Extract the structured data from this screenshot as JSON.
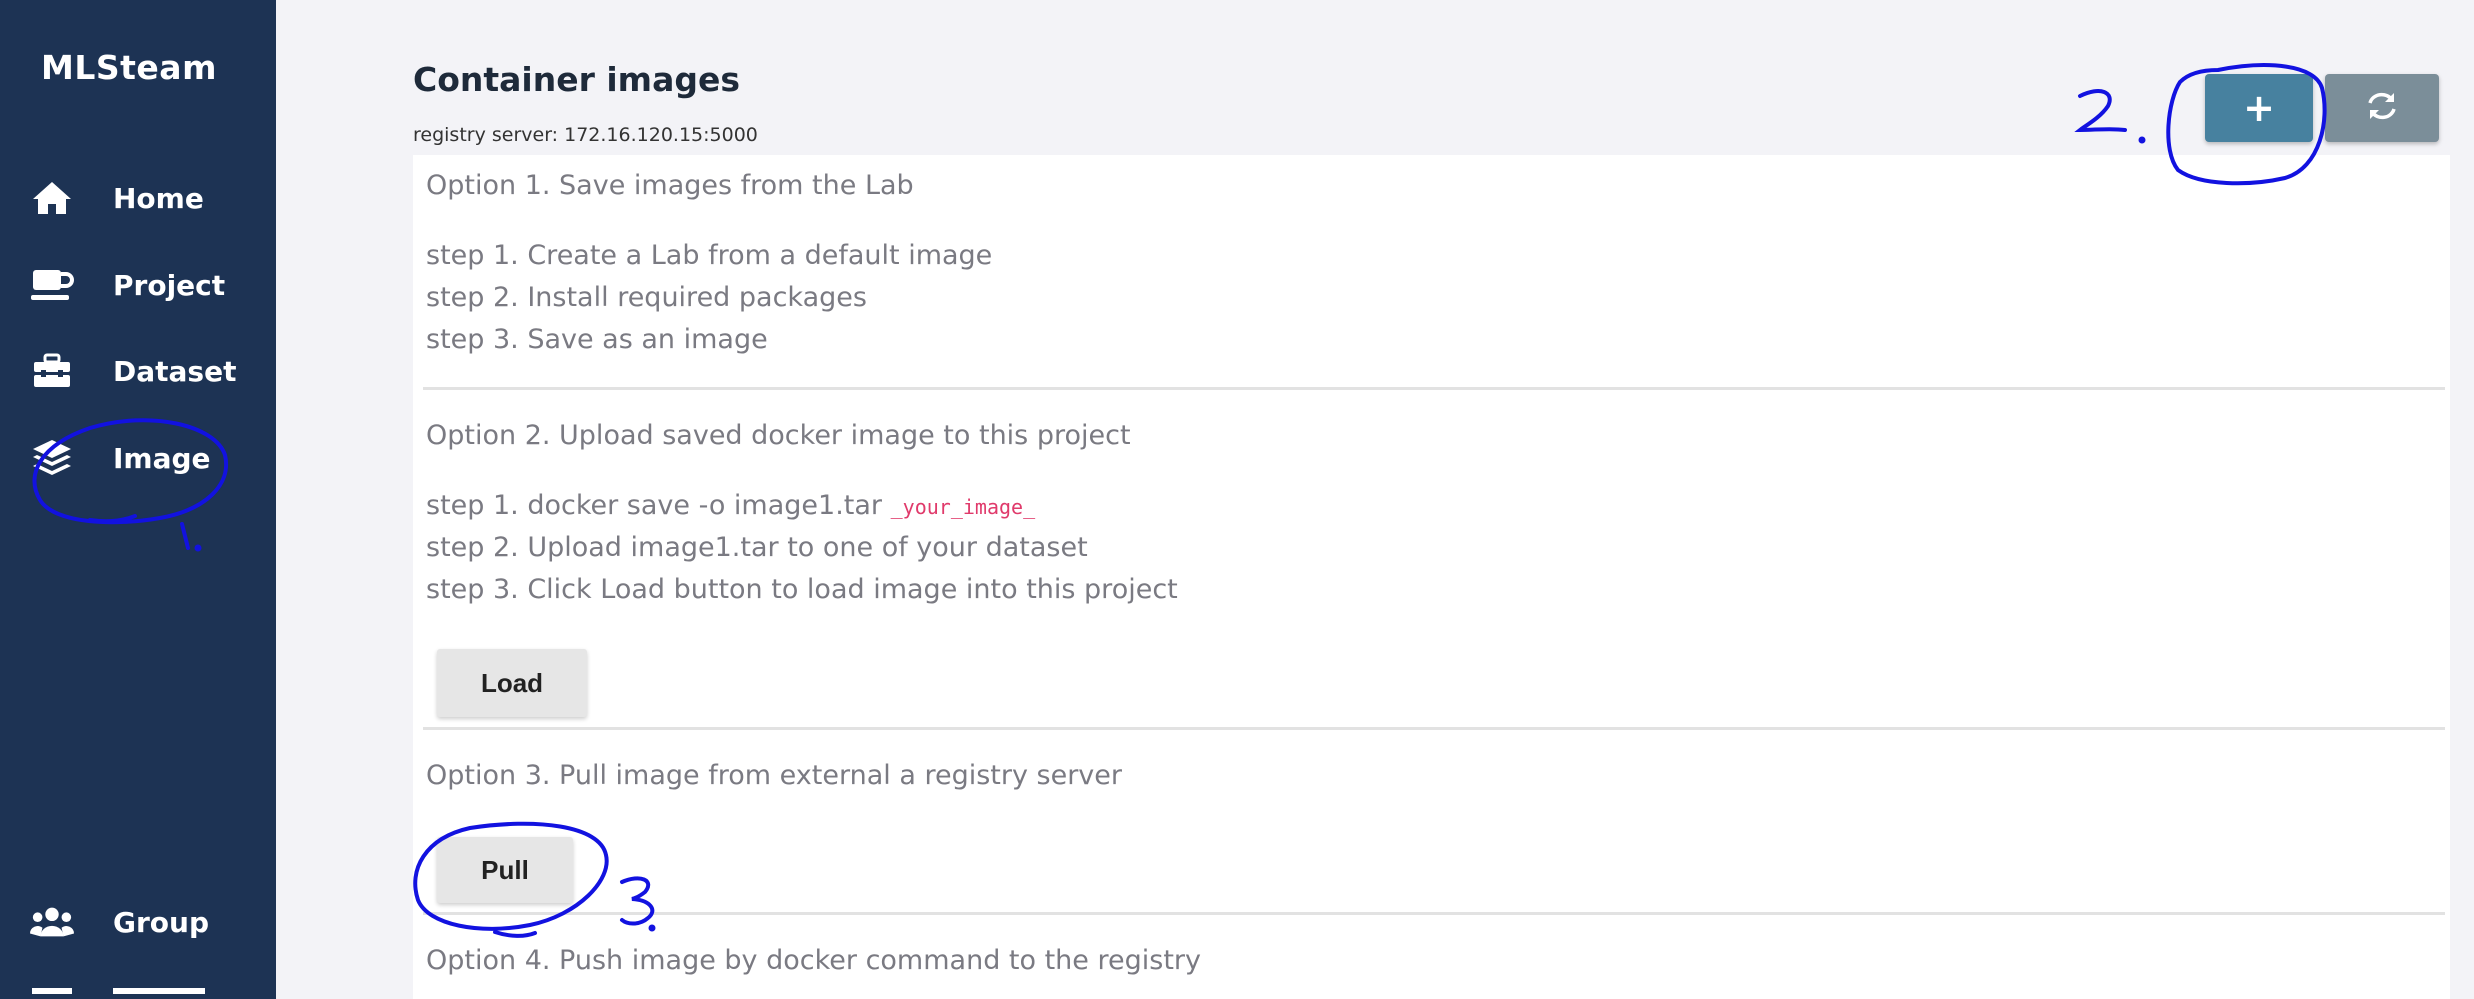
{
  "app": {
    "brand": "MLSteam"
  },
  "sidebar": {
    "items": [
      {
        "label": "Home",
        "icon": "home-icon"
      },
      {
        "label": "Project",
        "icon": "coffee-cup-icon"
      },
      {
        "label": "Dataset",
        "icon": "toolbox-icon"
      },
      {
        "label": "Image",
        "icon": "layers-icon"
      },
      {
        "label": "Group",
        "icon": "users-icon"
      }
    ]
  },
  "header": {
    "title": "Container images",
    "registry": "registry server: 172.16.120.15:5000",
    "add_label": "+",
    "refresh_icon": "refresh-icon",
    "add_color": "#47819f",
    "refresh_color": "#7b8e99"
  },
  "options": {
    "option1": {
      "title": "Option 1. Save images from the Lab",
      "steps": [
        "step 1. Create a Lab from a default image",
        "step 2. Install required packages",
        "step 3. Save as an image"
      ]
    },
    "option2": {
      "title": "Option 2. Upload saved docker image to this project",
      "step1_text": "step 1. docker save -o image1.tar",
      "step1_code": "_your_image_",
      "steps": [
        "step 2. Upload image1.tar to one of your dataset",
        "step 3. Click Load button to load image into this project"
      ],
      "load_label": "Load"
    },
    "option3": {
      "title": "Option 3. Pull image from external a registry server",
      "pull_label": "Pull"
    },
    "option4": {
      "title": "Option 4. Push image by docker command to the registry"
    }
  },
  "annotations": {
    "marks": [
      "1.",
      "2.",
      "3."
    ],
    "color": "#1212e0"
  },
  "colors": {
    "sidebar_bg": "#1d3354",
    "page_bg": "#f3f3f7",
    "code_pink": "#e03a6b"
  }
}
